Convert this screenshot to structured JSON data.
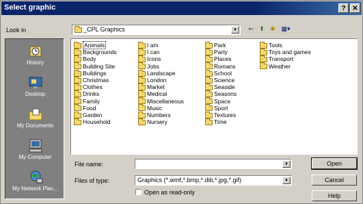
{
  "window": {
    "title": "Select graphic",
    "help_glyph": "?",
    "close_glyph": "✕"
  },
  "lookin": {
    "label": "Look in",
    "value": "_CPL Graphics"
  },
  "toolbar": {
    "back_glyph": "⇐",
    "up_glyph": "⬆",
    "newfolder_glyph": "✱",
    "views_glyph": "▦"
  },
  "places": [
    {
      "label": "History",
      "icon": "history-icon"
    },
    {
      "label": "Desktop",
      "icon": "desktop-icon"
    },
    {
      "label": "My Documents",
      "icon": "my-documents-icon"
    },
    {
      "label": "My Computer",
      "icon": "my-computer-icon"
    },
    {
      "label": "My Network Plac...",
      "icon": "my-network-places-icon"
    }
  ],
  "folders": {
    "col1": [
      "Animals",
      "Backgrounds",
      "Body",
      "Building Site",
      "Buildings",
      "Christmas",
      "Clothes",
      "Drinks",
      "Family",
      "Food",
      "Garden",
      "Household"
    ],
    "col2": [
      "I am",
      "I can",
      "Icons",
      "Jobs",
      "Landscape",
      "London",
      "Market",
      "Medical",
      "Miscellaneous",
      "Music",
      "Numbers",
      "Nursery"
    ],
    "col3": [
      "Park",
      "Party",
      "Places",
      "Romans",
      "School",
      "Science",
      "Seaside",
      "Seasons",
      "Space",
      "Sport",
      "Textures",
      "Time"
    ],
    "col4": [
      "Tools",
      "Toys and games",
      "Transport",
      "Weather"
    ]
  },
  "selected_folder": "Animals",
  "filename": {
    "label": "File name:",
    "value": ""
  },
  "filetype": {
    "label": "Files of type:",
    "value": "Graphics (*.wmf,*.bmp,*.dib,*.jpg,*.gif)"
  },
  "readonly": {
    "label": "Open as read-only",
    "checked": false
  },
  "buttons": {
    "open": "Open",
    "cancel": "Cancel",
    "help": "Help"
  }
}
